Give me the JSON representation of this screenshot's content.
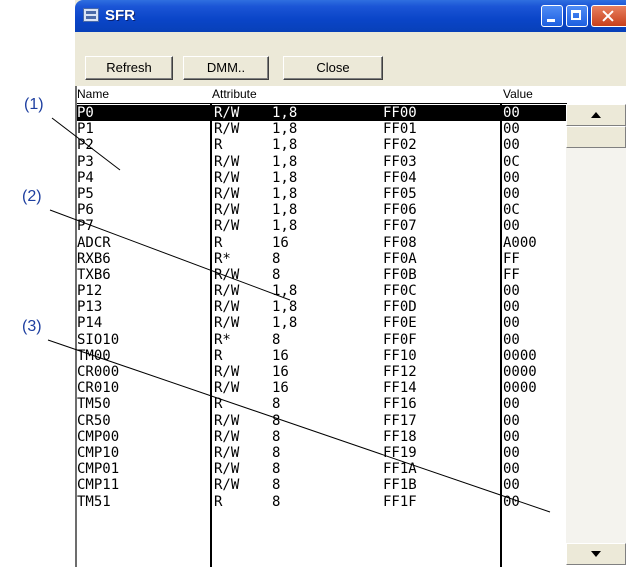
{
  "window": {
    "title": "SFR",
    "icon": "window-app-icon"
  },
  "title_buttons": {
    "minimize": "minimize-icon",
    "maximize": "maximize-icon",
    "close": "close-icon"
  },
  "toolbar": {
    "refresh_label": "Refresh",
    "dmm_label": "DMM..",
    "close_label": "Close"
  },
  "columns": {
    "name": "Name",
    "attribute": "Attribute",
    "value": "Value"
  },
  "rows": [
    {
      "name": "P0",
      "rw": "R/W",
      "size": "1,8",
      "addr": "FF00",
      "value": "00"
    },
    {
      "name": "P1",
      "rw": "R/W",
      "size": "1,8",
      "addr": "FF01",
      "value": "00"
    },
    {
      "name": "P2",
      "rw": "R",
      "size": "1,8",
      "addr": "FF02",
      "value": "00"
    },
    {
      "name": "P3",
      "rw": "R/W",
      "size": "1,8",
      "addr": "FF03",
      "value": "0C"
    },
    {
      "name": "P4",
      "rw": "R/W",
      "size": "1,8",
      "addr": "FF04",
      "value": "00"
    },
    {
      "name": "P5",
      "rw": "R/W",
      "size": "1,8",
      "addr": "FF05",
      "value": "00"
    },
    {
      "name": "P6",
      "rw": "R/W",
      "size": "1,8",
      "addr": "FF06",
      "value": "0C"
    },
    {
      "name": "P7",
      "rw": "R/W",
      "size": "1,8",
      "addr": "FF07",
      "value": "00"
    },
    {
      "name": "ADCR",
      "rw": "R",
      "size": "16",
      "addr": "FF08",
      "value": "A000"
    },
    {
      "name": "RXB6",
      "rw": "R*",
      "size": "8",
      "addr": "FF0A",
      "value": "FF"
    },
    {
      "name": "TXB6",
      "rw": "R/W",
      "size": "8",
      "addr": "FF0B",
      "value": "FF"
    },
    {
      "name": "P12",
      "rw": "R/W",
      "size": "1,8",
      "addr": "FF0C",
      "value": "00"
    },
    {
      "name": "P13",
      "rw": "R/W",
      "size": "1,8",
      "addr": "FF0D",
      "value": "00"
    },
    {
      "name": "P14",
      "rw": "R/W",
      "size": "1,8",
      "addr": "FF0E",
      "value": "00"
    },
    {
      "name": "SIO10",
      "rw": "R*",
      "size": "8",
      "addr": "FF0F",
      "value": "00"
    },
    {
      "name": "TM00",
      "rw": "R",
      "size": "16",
      "addr": "FF10",
      "value": "0000"
    },
    {
      "name": "CR000",
      "rw": "R/W",
      "size": "16",
      "addr": "FF12",
      "value": "0000"
    },
    {
      "name": "CR010",
      "rw": "R/W",
      "size": "16",
      "addr": "FF14",
      "value": "0000"
    },
    {
      "name": "TM50",
      "rw": "R",
      "size": "8",
      "addr": "FF16",
      "value": "00"
    },
    {
      "name": "CR50",
      "rw": "R/W",
      "size": "8",
      "addr": "FF17",
      "value": "00"
    },
    {
      "name": "CMP00",
      "rw": "R/W",
      "size": "8",
      "addr": "FF18",
      "value": "00"
    },
    {
      "name": "CMP10",
      "rw": "R/W",
      "size": "8",
      "addr": "FF19",
      "value": "00"
    },
    {
      "name": "CMP01",
      "rw": "R/W",
      "size": "8",
      "addr": "FF1A",
      "value": "00"
    },
    {
      "name": "CMP11",
      "rw": "R/W",
      "size": "8",
      "addr": "FF1B",
      "value": "00"
    },
    {
      "name": "TM51",
      "rw": "R",
      "size": "8",
      "addr": "FF1F",
      "value": "00"
    }
  ],
  "selected_row": 0,
  "scrollbar": {
    "up": "scroll-up-arrow-icon",
    "down": "scroll-down-arrow-icon"
  },
  "callouts": [
    "(1)",
    "(2)",
    "(3)"
  ],
  "colors": {
    "titlebar": "#0a45c8",
    "callout": "#1e3fa0",
    "selection": "#000000"
  }
}
